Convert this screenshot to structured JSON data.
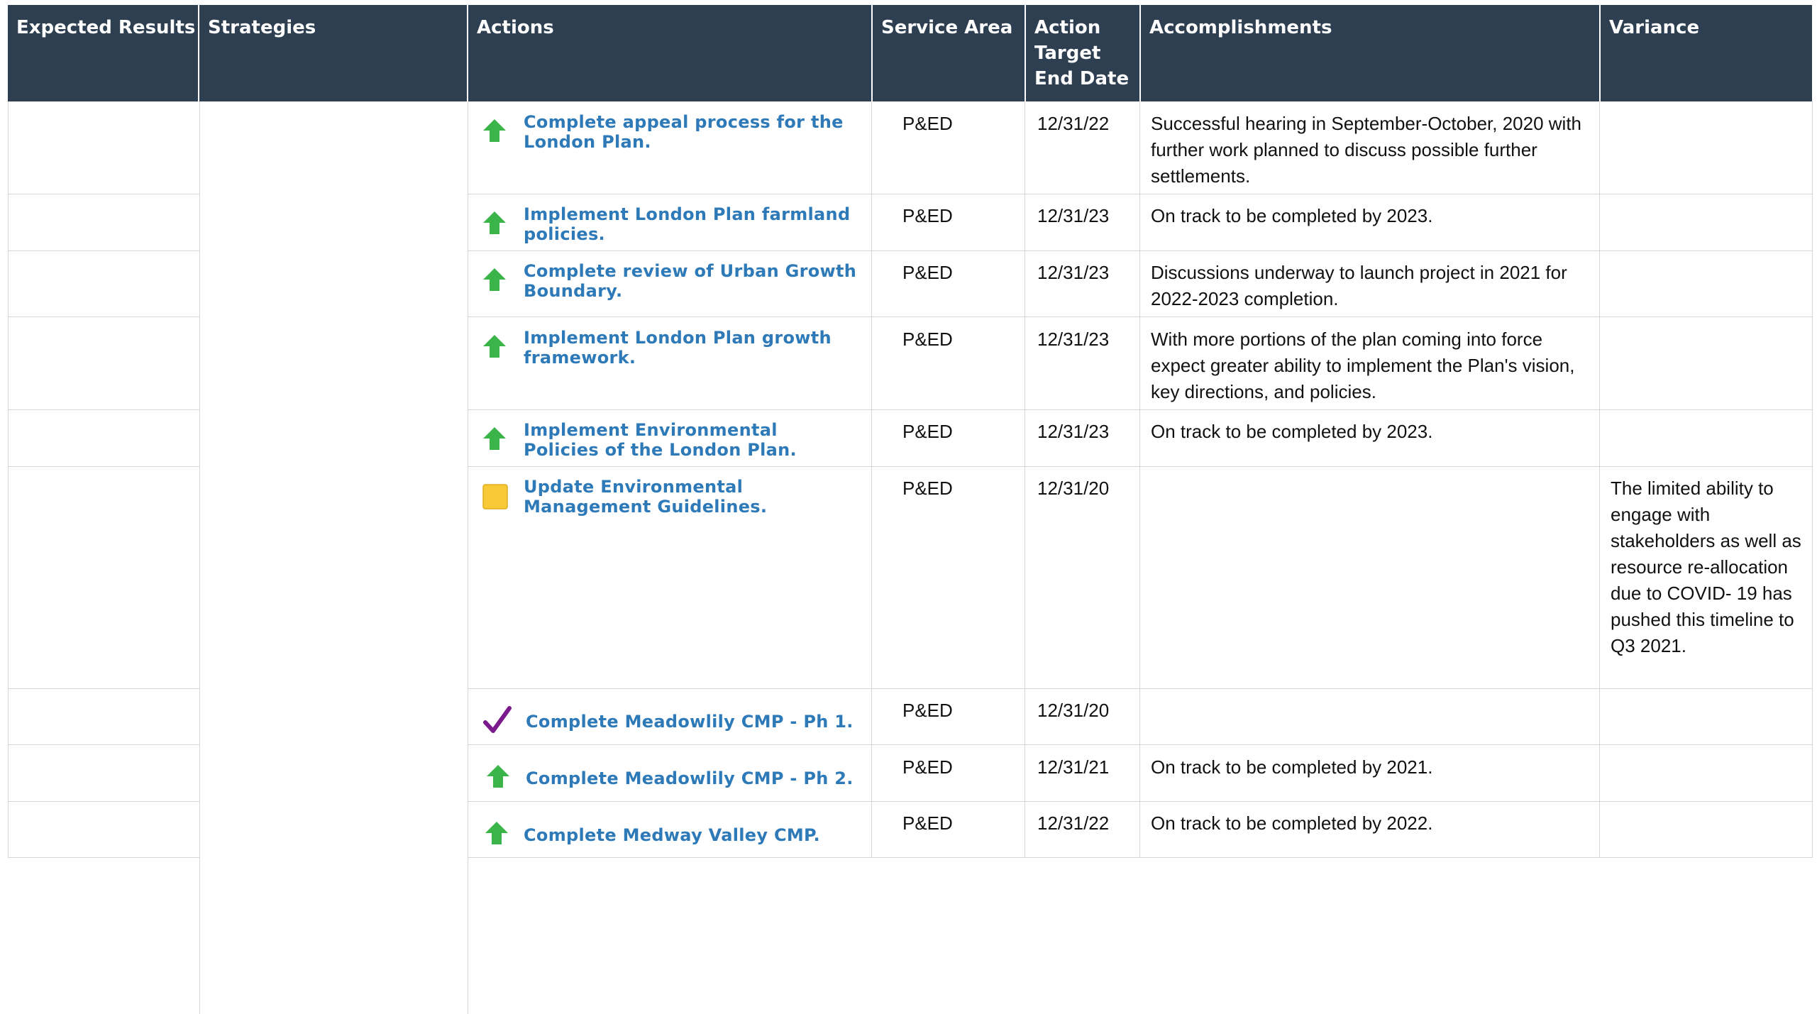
{
  "table": {
    "headers": {
      "expected_results": "Expected Results",
      "strategies": "Strategies",
      "actions": "Actions",
      "service_area": "Service Area",
      "target_date": "Action Target End Date",
      "accomplishments": "Accomplishments",
      "variance": "Variance"
    },
    "rows": [
      {
        "status_icon": "green-up-arrow-icon",
        "action": "Complete appeal process for the London Plan.",
        "service_area": "P&ED",
        "target_date": "12/31/22",
        "accomplishments": "Successful hearing in September-October, 2020 with further work planned to discuss possible further settlements.",
        "variance": ""
      },
      {
        "status_icon": "green-up-arrow-icon",
        "action": "Implement London Plan farmland policies.",
        "service_area": "P&ED",
        "target_date": "12/31/23",
        "accomplishments": "On track to be completed by 2023.",
        "variance": ""
      },
      {
        "status_icon": "green-up-arrow-icon",
        "action": "Complete review of Urban Growth Boundary.",
        "service_area": "P&ED",
        "target_date": "12/31/23",
        "accomplishments": "Discussions underway to launch project in 2021 for 2022-2023 completion.",
        "variance": ""
      },
      {
        "status_icon": "green-up-arrow-icon",
        "action": "Implement London Plan growth framework.",
        "service_area": "P&ED",
        "target_date": "12/31/23",
        "accomplishments": "With more portions of the plan coming into force expect greater ability to implement the Plan's vision, key directions, and policies.",
        "variance": ""
      },
      {
        "status_icon": "green-up-arrow-icon",
        "action": "Implement Environmental Policies of the London Plan.",
        "service_area": "P&ED",
        "target_date": "12/31/23",
        "accomplishments": "On track to be completed by 2023.",
        "variance": ""
      },
      {
        "status_icon": "yellow-square-icon",
        "action": "Update Environmental Management Guidelines.",
        "service_area": "P&ED",
        "target_date": "12/31/20",
        "accomplishments": "",
        "variance": "The limited ability to engage with stakeholders as well as resource re-allocation due to COVID- 19 has pushed this timeline to Q3 2021."
      },
      {
        "status_icon": "purple-checkmark-icon",
        "action": "Complete Meadowlily CMP - Ph 1.",
        "service_area": "P&ED",
        "target_date": "12/31/20",
        "accomplishments": "",
        "variance": ""
      },
      {
        "status_icon": "green-up-arrow-icon",
        "action": "Complete Meadowlily CMP - Ph 2.",
        "service_area": "P&ED",
        "target_date": "12/31/21",
        "accomplishments": "On track to be completed by 2021.",
        "variance": ""
      },
      {
        "status_icon": "green-up-arrow-icon",
        "action": "Complete Medway Valley CMP.",
        "service_area": "P&ED",
        "target_date": "12/31/22",
        "accomplishments": "On track to be completed by 2022.",
        "variance": ""
      }
    ]
  },
  "colors": {
    "header_bg": "#2e3f51",
    "action_link": "#2e7ab8",
    "status_on_track": "#3bb54a",
    "status_caution": "#f7c936",
    "status_complete": "#7a1a8c"
  }
}
